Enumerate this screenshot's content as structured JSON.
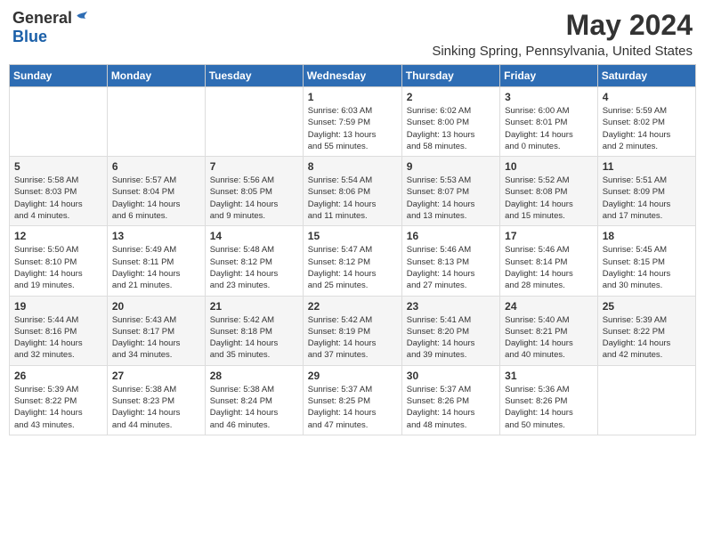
{
  "header": {
    "logo_general": "General",
    "logo_blue": "Blue",
    "month_title": "May 2024",
    "location": "Sinking Spring, Pennsylvania, United States"
  },
  "weekdays": [
    "Sunday",
    "Monday",
    "Tuesday",
    "Wednesday",
    "Thursday",
    "Friday",
    "Saturday"
  ],
  "weeks": [
    [
      {
        "day": "",
        "info": ""
      },
      {
        "day": "",
        "info": ""
      },
      {
        "day": "",
        "info": ""
      },
      {
        "day": "1",
        "info": "Sunrise: 6:03 AM\nSunset: 7:59 PM\nDaylight: 13 hours\nand 55 minutes."
      },
      {
        "day": "2",
        "info": "Sunrise: 6:02 AM\nSunset: 8:00 PM\nDaylight: 13 hours\nand 58 minutes."
      },
      {
        "day": "3",
        "info": "Sunrise: 6:00 AM\nSunset: 8:01 PM\nDaylight: 14 hours\nand 0 minutes."
      },
      {
        "day": "4",
        "info": "Sunrise: 5:59 AM\nSunset: 8:02 PM\nDaylight: 14 hours\nand 2 minutes."
      }
    ],
    [
      {
        "day": "5",
        "info": "Sunrise: 5:58 AM\nSunset: 8:03 PM\nDaylight: 14 hours\nand 4 minutes."
      },
      {
        "day": "6",
        "info": "Sunrise: 5:57 AM\nSunset: 8:04 PM\nDaylight: 14 hours\nand 6 minutes."
      },
      {
        "day": "7",
        "info": "Sunrise: 5:56 AM\nSunset: 8:05 PM\nDaylight: 14 hours\nand 9 minutes."
      },
      {
        "day": "8",
        "info": "Sunrise: 5:54 AM\nSunset: 8:06 PM\nDaylight: 14 hours\nand 11 minutes."
      },
      {
        "day": "9",
        "info": "Sunrise: 5:53 AM\nSunset: 8:07 PM\nDaylight: 14 hours\nand 13 minutes."
      },
      {
        "day": "10",
        "info": "Sunrise: 5:52 AM\nSunset: 8:08 PM\nDaylight: 14 hours\nand 15 minutes."
      },
      {
        "day": "11",
        "info": "Sunrise: 5:51 AM\nSunset: 8:09 PM\nDaylight: 14 hours\nand 17 minutes."
      }
    ],
    [
      {
        "day": "12",
        "info": "Sunrise: 5:50 AM\nSunset: 8:10 PM\nDaylight: 14 hours\nand 19 minutes."
      },
      {
        "day": "13",
        "info": "Sunrise: 5:49 AM\nSunset: 8:11 PM\nDaylight: 14 hours\nand 21 minutes."
      },
      {
        "day": "14",
        "info": "Sunrise: 5:48 AM\nSunset: 8:12 PM\nDaylight: 14 hours\nand 23 minutes."
      },
      {
        "day": "15",
        "info": "Sunrise: 5:47 AM\nSunset: 8:12 PM\nDaylight: 14 hours\nand 25 minutes."
      },
      {
        "day": "16",
        "info": "Sunrise: 5:46 AM\nSunset: 8:13 PM\nDaylight: 14 hours\nand 27 minutes."
      },
      {
        "day": "17",
        "info": "Sunrise: 5:46 AM\nSunset: 8:14 PM\nDaylight: 14 hours\nand 28 minutes."
      },
      {
        "day": "18",
        "info": "Sunrise: 5:45 AM\nSunset: 8:15 PM\nDaylight: 14 hours\nand 30 minutes."
      }
    ],
    [
      {
        "day": "19",
        "info": "Sunrise: 5:44 AM\nSunset: 8:16 PM\nDaylight: 14 hours\nand 32 minutes."
      },
      {
        "day": "20",
        "info": "Sunrise: 5:43 AM\nSunset: 8:17 PM\nDaylight: 14 hours\nand 34 minutes."
      },
      {
        "day": "21",
        "info": "Sunrise: 5:42 AM\nSunset: 8:18 PM\nDaylight: 14 hours\nand 35 minutes."
      },
      {
        "day": "22",
        "info": "Sunrise: 5:42 AM\nSunset: 8:19 PM\nDaylight: 14 hours\nand 37 minutes."
      },
      {
        "day": "23",
        "info": "Sunrise: 5:41 AM\nSunset: 8:20 PM\nDaylight: 14 hours\nand 39 minutes."
      },
      {
        "day": "24",
        "info": "Sunrise: 5:40 AM\nSunset: 8:21 PM\nDaylight: 14 hours\nand 40 minutes."
      },
      {
        "day": "25",
        "info": "Sunrise: 5:39 AM\nSunset: 8:22 PM\nDaylight: 14 hours\nand 42 minutes."
      }
    ],
    [
      {
        "day": "26",
        "info": "Sunrise: 5:39 AM\nSunset: 8:22 PM\nDaylight: 14 hours\nand 43 minutes."
      },
      {
        "day": "27",
        "info": "Sunrise: 5:38 AM\nSunset: 8:23 PM\nDaylight: 14 hours\nand 44 minutes."
      },
      {
        "day": "28",
        "info": "Sunrise: 5:38 AM\nSunset: 8:24 PM\nDaylight: 14 hours\nand 46 minutes."
      },
      {
        "day": "29",
        "info": "Sunrise: 5:37 AM\nSunset: 8:25 PM\nDaylight: 14 hours\nand 47 minutes."
      },
      {
        "day": "30",
        "info": "Sunrise: 5:37 AM\nSunset: 8:26 PM\nDaylight: 14 hours\nand 48 minutes."
      },
      {
        "day": "31",
        "info": "Sunrise: 5:36 AM\nSunset: 8:26 PM\nDaylight: 14 hours\nand 50 minutes."
      },
      {
        "day": "",
        "info": ""
      }
    ]
  ]
}
